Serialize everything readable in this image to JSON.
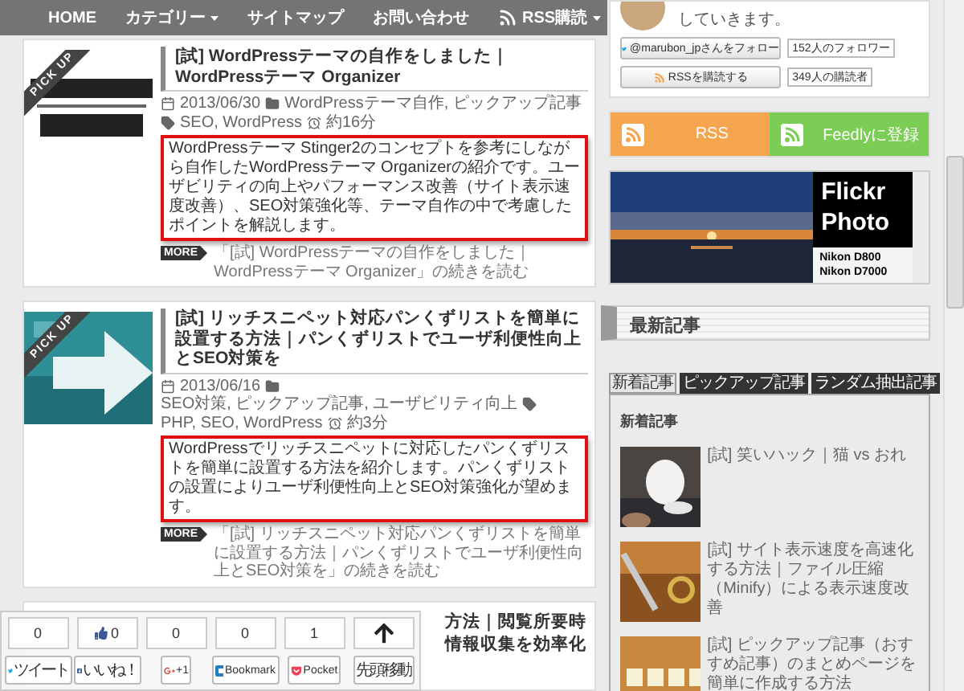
{
  "nav": [
    {
      "label": "HOME",
      "kind": "link"
    },
    {
      "label": "カテゴリー",
      "kind": "dropdown"
    },
    {
      "label": "サイトマップ",
      "kind": "link"
    },
    {
      "label": "お問い合わせ",
      "kind": "link"
    },
    {
      "label": "RSS購読",
      "kind": "rss-dropdown"
    }
  ],
  "posts": [
    {
      "badge": "PICK UP",
      "title": "[試] WordPressテーマの自作をしました｜WordPressテーマ Organizer",
      "date": "2013/06/30",
      "categories": "WordPressテーマ自作, ピックアップ記事",
      "tags": "SEO, WordPress",
      "read_time": "約16分",
      "excerpt": "WordPressテーマ Stinger2のコンセプトを参考にしながら自作したWordPressテーマ Organizerの紹介です。ユーザビリティの向上やパフォーマンス改善（サイト表示速度改善）、SEO対策強化等、テーマ自作の中で考慮したポイントを解説します。",
      "more_badge": "MORE",
      "more": "「[試] WordPressテーマの自作をしました｜WordPressテーマ Organizer」の続きを読む"
    },
    {
      "badge": "PICK UP",
      "title": "[試] リッチスニペット対応パンくずリストを簡単に設置する方法｜パンくずリストでユーザ利便性向上とSEO対策を",
      "date": "2013/06/16",
      "categories": "SEO対策, ピックアップ記事, ユーザビリティ向上",
      "tags": "PHP, SEO, WordPress",
      "read_time": "約3分",
      "excerpt": "WordPressでリッチスニペットに対応したパンくずリストを簡単に設置する方法を紹介します。パンくずリストの設置によりユーザ利便性向上とSEO対策強化が望めます。",
      "more_badge": "MORE",
      "more": "「[試] リッチスニペット対応パンくずリストを簡単に設置する方法｜パンくずリストでユーザ利便性向上とSEO対策を」の続きを読む"
    }
  ],
  "partial_post": {
    "title_lines": [
      "方法｜閲覧所要時",
      "情報収集を効率化"
    ]
  },
  "share": [
    {
      "kind": "twitter",
      "count": "0",
      "label": "ツイート"
    },
    {
      "kind": "facebook",
      "count": "0",
      "label": "いいね！"
    },
    {
      "kind": "google",
      "count": "0",
      "label": "+1"
    },
    {
      "kind": "hatena",
      "count": "0",
      "label": "Bookmark"
    },
    {
      "kind": "pocket",
      "count": "1",
      "label": "Pocket"
    },
    {
      "kind": "top",
      "label": "先頭移動"
    }
  ],
  "sidebar": {
    "profile_tail": "していきます。",
    "follow": {
      "label": "@marubon_jpさんをフォロー",
      "count": "152人のフォロワー"
    },
    "subscribe": {
      "label": "RSSを購読する",
      "count": "349人の購読者"
    },
    "feeds": [
      {
        "label": "RSS",
        "color": "#f5a54e"
      },
      {
        "label": "Feedlyに登録",
        "color": "#7ccd55"
      }
    ],
    "flickr": {
      "title_lines": [
        "Flickr",
        "Photo"
      ],
      "cameras": [
        "Nikon D800",
        "Nikon D7000"
      ]
    },
    "heading": "最新記事",
    "tabs": [
      {
        "label": "新着記事",
        "selected": true
      },
      {
        "label": "ピックアップ記事",
        "selected": false
      },
      {
        "label": "ランダム抽出記事",
        "selected": false
      }
    ],
    "panel_heading": "新着記事",
    "items": [
      {
        "title": "[試] 笑いハック｜猫 vs おれ"
      },
      {
        "title": "[試] サイト表示速度を高速化する方法｜ファイル圧縮（Minify）による表示速度改善"
      },
      {
        "title": "[試] ピックアップ記事（おすすめ記事）のまとめページを簡単に作成する方法"
      }
    ]
  }
}
